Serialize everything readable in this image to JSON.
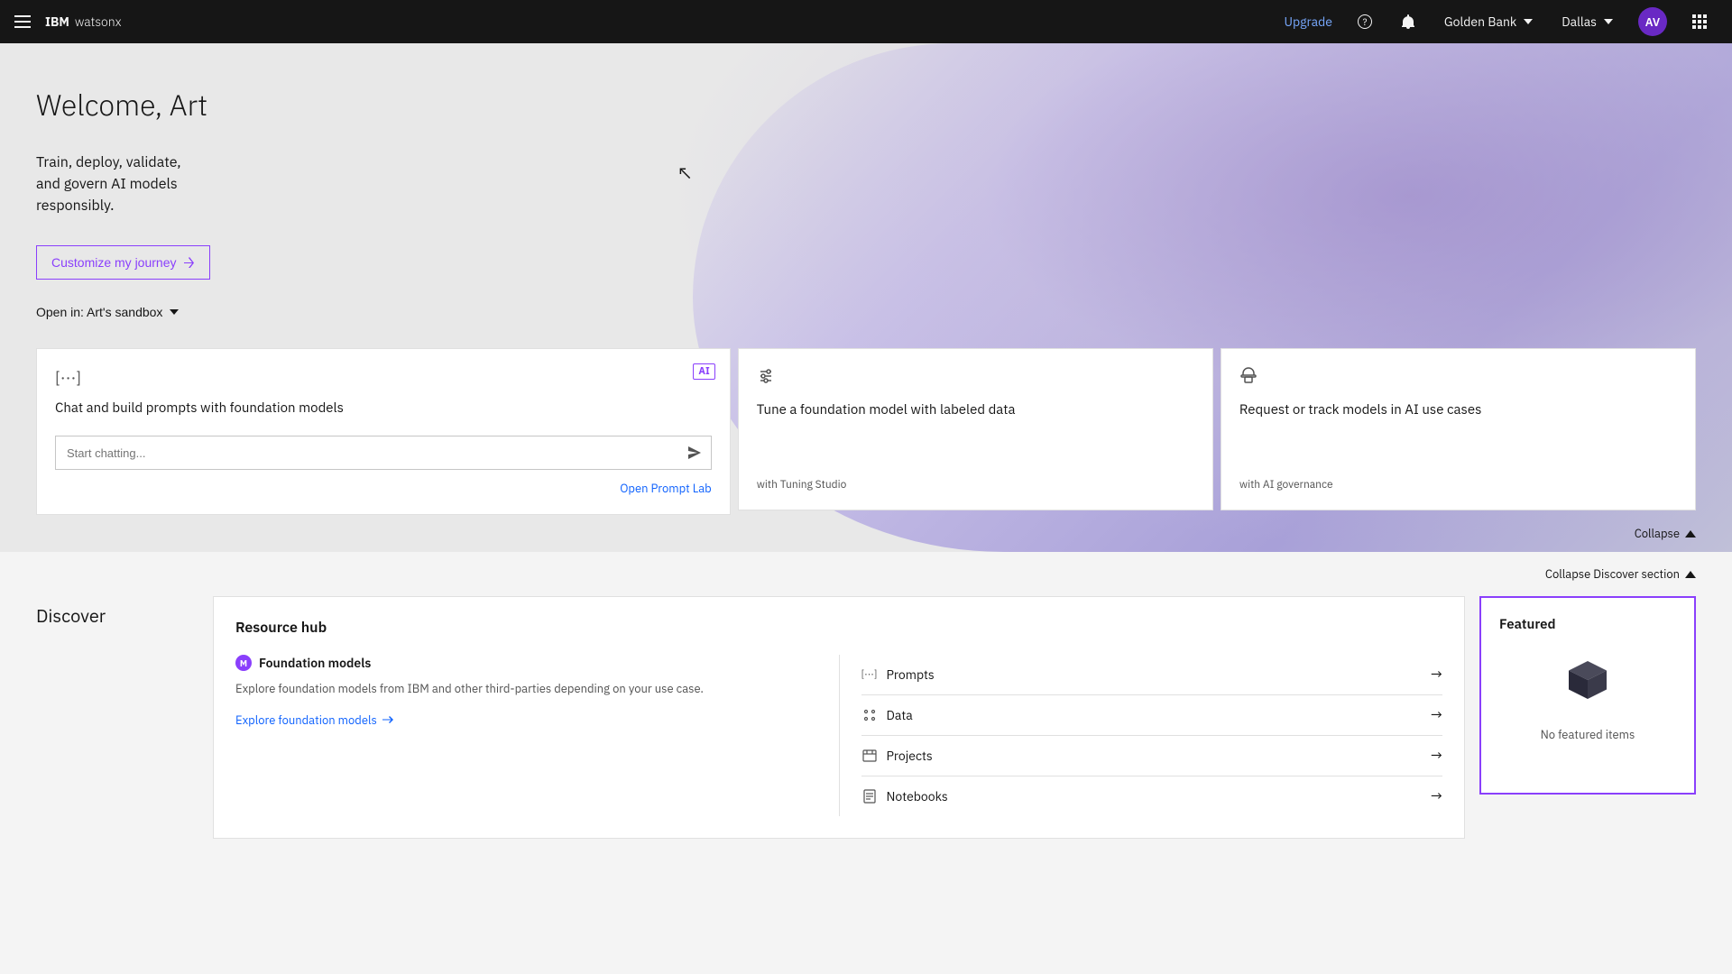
{
  "topbar": {
    "hamburger_label": "Menu",
    "brand_ibm": "IBM",
    "brand_product": "watsonx",
    "upgrade_label": "Upgrade",
    "help_label": "Help",
    "notifications_label": "Notifications",
    "org_name": "Golden Bank",
    "region_name": "Dallas",
    "avatar_initials": "AV",
    "apps_label": "Apps"
  },
  "hero": {
    "welcome": "Welcome, Art",
    "subtitle_line1": "Train, deploy, validate,",
    "subtitle_line2": "and govern AI models",
    "subtitle_line3": "responsibly.",
    "open_in_label": "Open in: Art's sandbox",
    "card_main_icon": "[···]",
    "card_main_title": "Chat and build prompts with foundation models",
    "card_main_placeholder": "Start chatting...",
    "card_main_link": "Open Prompt Lab",
    "card_ai_badge": "AI",
    "card_tune_icon": "⚙",
    "card_tune_title": "Tune a foundation model with labeled data",
    "card_tune_subtitle": "with Tuning Studio",
    "card_govern_icon": "⚖",
    "card_govern_title": "Request or track models in AI use cases",
    "card_govern_subtitle": "with AI governance",
    "customize_btn": "Customize my journey",
    "collapse_label": "Collapse"
  },
  "discover": {
    "label": "Discover",
    "collapse_discover_label": "Collapse Discover section",
    "resource_hub_title": "Resource hub",
    "foundation_models_header": "Foundation models",
    "foundation_models_icon": "M",
    "foundation_models_desc": "Explore foundation models from IBM and other third-parties depending on your use case.",
    "explore_link": "Explore foundation models",
    "list_items": [
      {
        "icon": "[···]",
        "label": "Prompts"
      },
      {
        "icon": "⊞",
        "label": "Data"
      },
      {
        "icon": "▦",
        "label": "Projects"
      },
      {
        "icon": "▤",
        "label": "Notebooks"
      }
    ],
    "featured_title": "Featured",
    "featured_empty": "No featured items"
  }
}
